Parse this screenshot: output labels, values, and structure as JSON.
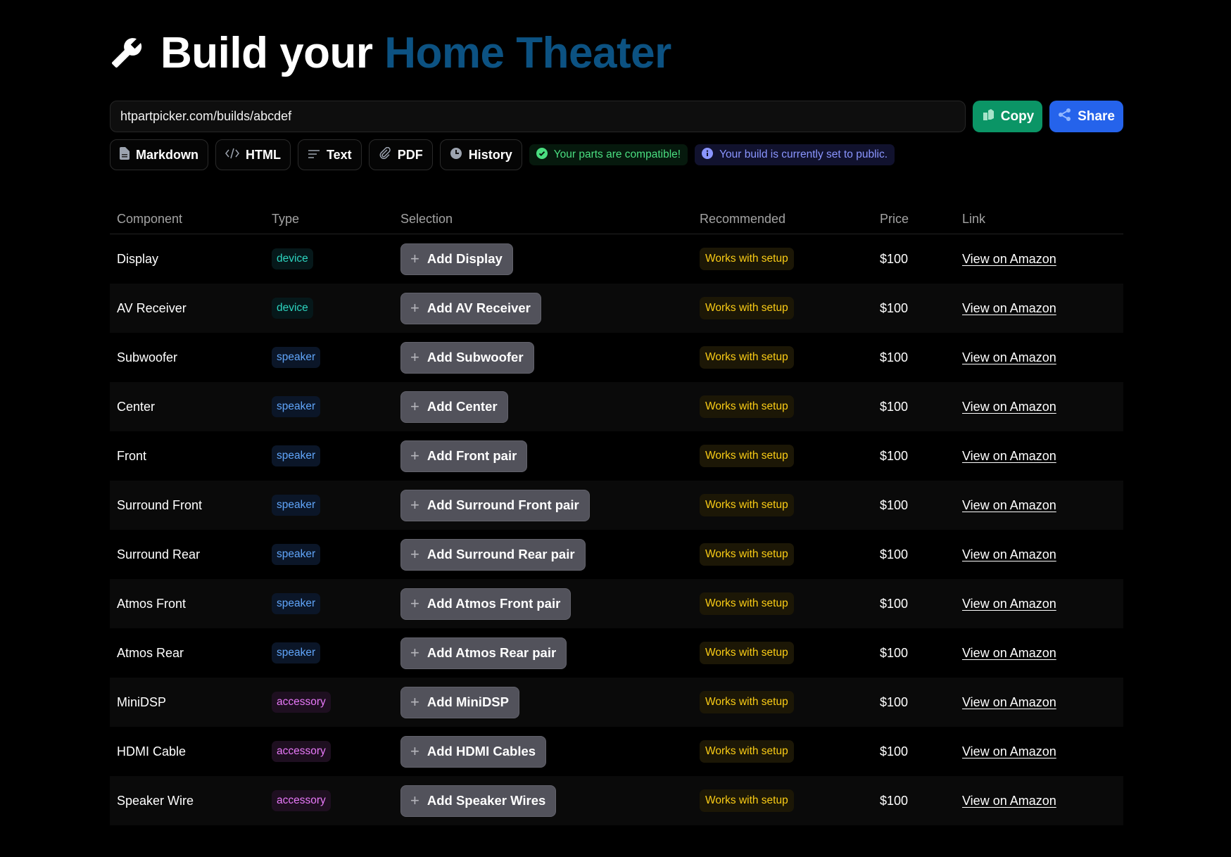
{
  "header": {
    "icon": "wrench-icon",
    "title_prefix": "Build your ",
    "title_accent": "Home Theater"
  },
  "share": {
    "url_value": "htpartpicker.com/builds/abcdef",
    "copy_label": "Copy",
    "share_label": "Share"
  },
  "export": {
    "markdown": "Markdown",
    "html": "HTML",
    "text": "Text",
    "pdf": "PDF",
    "history": "History"
  },
  "status": {
    "compatible": "Your parts are compatible!",
    "visibility": "Your build is currently set to public."
  },
  "colors": {
    "accent": "#0c5282",
    "copy": "#0b9566",
    "share": "#2563eb",
    "device": "#2dd4bf",
    "speaker": "#60a5fa",
    "accessory": "#e879f9",
    "recommended": "#facc15"
  },
  "table": {
    "headers": {
      "component": "Component",
      "type": "Type",
      "selection": "Selection",
      "recommended": "Recommended",
      "price": "Price",
      "link": "Link"
    },
    "rows": [
      {
        "component": "Display",
        "type": "device",
        "selection": "Add Display",
        "recommended": "Works with setup",
        "price": "$100",
        "link": "View on Amazon"
      },
      {
        "component": "AV Receiver",
        "type": "device",
        "selection": "Add AV Receiver",
        "recommended": "Works with setup",
        "price": "$100",
        "link": "View on Amazon"
      },
      {
        "component": "Subwoofer",
        "type": "speaker",
        "selection": "Add Subwoofer",
        "recommended": "Works with setup",
        "price": "$100",
        "link": "View on Amazon"
      },
      {
        "component": "Center",
        "type": "speaker",
        "selection": "Add Center",
        "recommended": "Works with setup",
        "price": "$100",
        "link": "View on Amazon"
      },
      {
        "component": "Front",
        "type": "speaker",
        "selection": "Add Front pair",
        "recommended": "Works with setup",
        "price": "$100",
        "link": "View on Amazon"
      },
      {
        "component": "Surround Front",
        "type": "speaker",
        "selection": "Add Surround Front pair",
        "recommended": "Works with setup",
        "price": "$100",
        "link": "View on Amazon"
      },
      {
        "component": "Surround Rear",
        "type": "speaker",
        "selection": "Add Surround Rear pair",
        "recommended": "Works with setup",
        "price": "$100",
        "link": "View on Amazon"
      },
      {
        "component": "Atmos Front",
        "type": "speaker",
        "selection": "Add Atmos Front pair",
        "recommended": "Works with setup",
        "price": "$100",
        "link": "View on Amazon"
      },
      {
        "component": "Atmos Rear",
        "type": "speaker",
        "selection": "Add Atmos Rear pair",
        "recommended": "Works with setup",
        "price": "$100",
        "link": "View on Amazon"
      },
      {
        "component": "MiniDSP",
        "type": "accessory",
        "selection": "Add MiniDSP",
        "recommended": "Works with setup",
        "price": "$100",
        "link": "View on Amazon"
      },
      {
        "component": "HDMI Cable",
        "type": "accessory",
        "selection": "Add HDMI Cables",
        "recommended": "Works with setup",
        "price": "$100",
        "link": "View on Amazon"
      },
      {
        "component": "Speaker Wire",
        "type": "accessory",
        "selection": "Add Speaker Wires",
        "recommended": "Works with setup",
        "price": "$100",
        "link": "View on Amazon"
      }
    ]
  }
}
